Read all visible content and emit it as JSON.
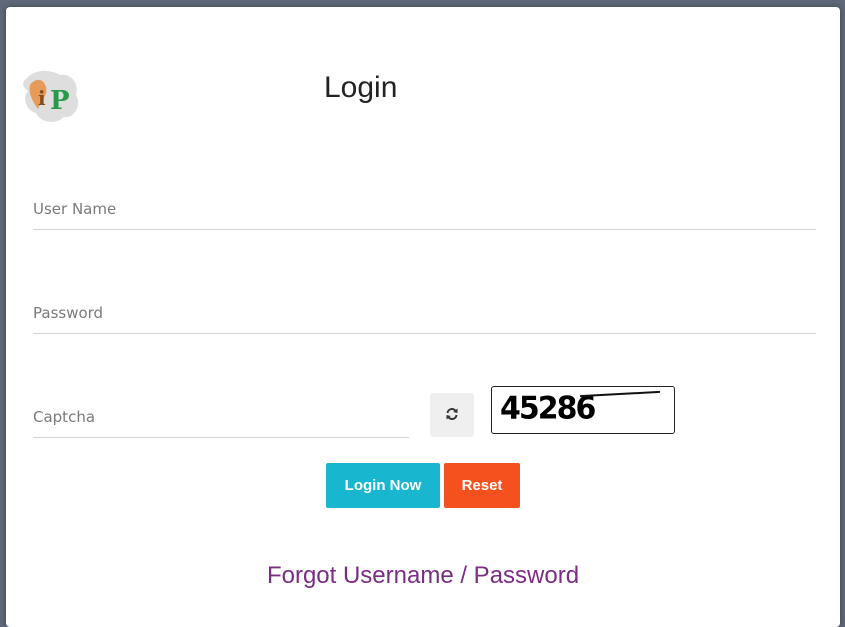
{
  "header": {
    "title": "Login"
  },
  "form": {
    "username_placeholder": "User Name",
    "password_placeholder": "Password",
    "captcha_placeholder": "Captcha",
    "captcha_code": "45286"
  },
  "buttons": {
    "login_label": "Login Now",
    "reset_label": "Reset"
  },
  "links": {
    "forgot_label": "Forgot Username / Password"
  },
  "icons": {
    "logo": "ip-logo-icon",
    "refresh": "refresh-icon"
  },
  "colors": {
    "login_button": "#18b7cf",
    "reset_button": "#f4511e",
    "forgot_link": "#7b2c83"
  }
}
